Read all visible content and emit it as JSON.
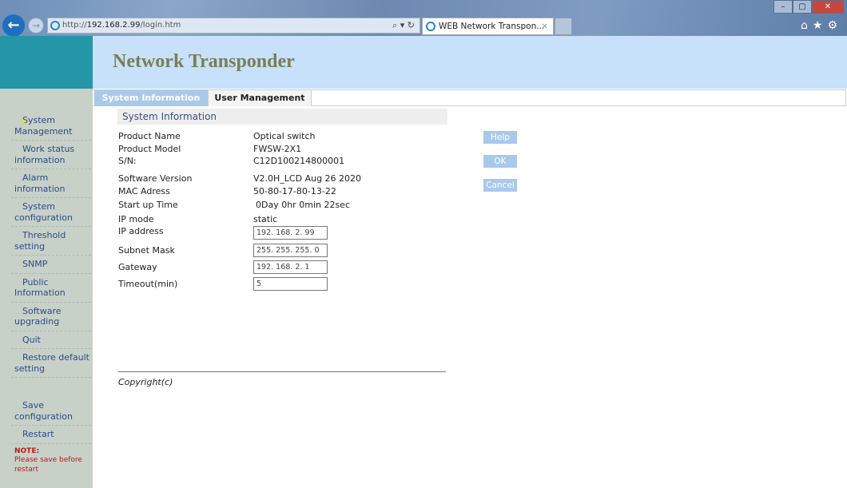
{
  "browser": {
    "url_prefix": "http://",
    "url_host": "192.168.2.99",
    "url_path": "/login.htm",
    "tab_title": "WEB Network Transpon...",
    "tab_close": "×",
    "search_refresh": "⌕ ▾ ↻",
    "window_buttons": [
      "–",
      "▢",
      "✕"
    ],
    "right_tools": "⌂★⚙"
  },
  "header": {
    "title": "Network Transponder"
  },
  "tabs": [
    {
      "label": "System Information",
      "active": true
    },
    {
      "label": "User Management",
      "active": false
    }
  ],
  "sidebar": {
    "items": [
      {
        "label": "System Management",
        "active": true
      },
      {
        "label": "Work status information"
      },
      {
        "label": "Alarm information"
      },
      {
        "label": "System configuration"
      },
      {
        "label": "Threshold setting"
      },
      {
        "label": "SNMP"
      },
      {
        "label": "Public Information"
      },
      {
        "label": "Software upgrading"
      },
      {
        "label": "Quit"
      },
      {
        "label": "Restore default setting"
      },
      {
        "label": "Save configuration"
      },
      {
        "label": "Restart"
      }
    ],
    "note_title": "NOTE:",
    "note_text": "Please save before restart"
  },
  "section": {
    "title": "System Information"
  },
  "info": {
    "product_name": {
      "label": "Product Name",
      "value": "Optical switch"
    },
    "product_model": {
      "label": "Product Model",
      "value": "FWSW-2X1"
    },
    "sn": {
      "label": "S/N:",
      "value": "C12D100214800001"
    },
    "software_version": {
      "label": "Software Version",
      "value": "V2.0H_LCD Aug 26 2020"
    },
    "mac": {
      "label": "MAC Adress",
      "value": "50-80-17-80-13-22"
    },
    "startup": {
      "label": "Start up Time",
      "value": "0Day 0hr 0min 22sec"
    },
    "ip_mode": {
      "label": "IP mode",
      "value": "static"
    },
    "ip_address": {
      "label": "IP address",
      "value": "192. 168. 2. 99"
    },
    "subnet": {
      "label": "Subnet Mask",
      "value": "255. 255. 255. 0"
    },
    "gateway": {
      "label": "Gateway",
      "value": "192. 168. 2. 1"
    },
    "timeout": {
      "label": "Timeout(min)",
      "value": "5"
    }
  },
  "buttons": {
    "help": "Help",
    "ok": "OK",
    "cancel": "Cancel"
  },
  "footer": {
    "copyright": "Copyright(c)"
  },
  "colors": {
    "header_bg": "#c6e1f9",
    "sidebar_bg": "#c7d1c8",
    "title": "#7a7e56",
    "tab_active": "#a9c9eb",
    "note": "#c01818"
  }
}
